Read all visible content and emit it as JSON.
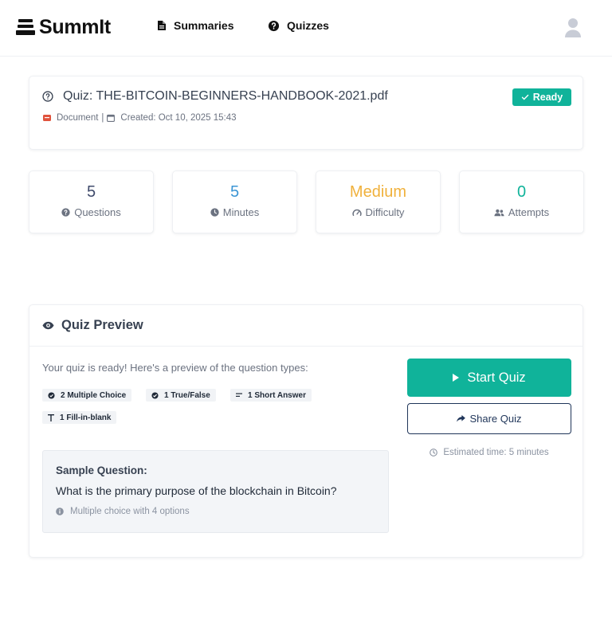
{
  "header": {
    "brand": "SummIt",
    "nav": [
      {
        "label": "Summaries",
        "icon": "document-icon"
      },
      {
        "label": "Quizzes",
        "icon": "question-circle-icon"
      }
    ],
    "avatar_icon": "user-icon"
  },
  "quiz": {
    "title": "Quiz: THE-BITCOIN-BEGINNERS-HANDBOOK-2021.pdf",
    "source_type": "Document",
    "meta_separator": "|",
    "created": "Created: Oct 10, 2025 15:43",
    "status": "Ready",
    "status_color": "#10b39a"
  },
  "stats": [
    {
      "value": "5",
      "label": "Questions",
      "color": "#3f4a6b",
      "icon": "question-circle-icon"
    },
    {
      "value": "5",
      "label": "Minutes",
      "color": "#3b95d4",
      "icon": "clock-icon"
    },
    {
      "value": "Medium",
      "label": "Difficulty",
      "color": "#f0b13c",
      "icon": "gauge-icon"
    },
    {
      "value": "0",
      "label": "Attempts",
      "color": "#10b39a",
      "icon": "users-icon"
    }
  ],
  "preview": {
    "title": "Quiz Preview",
    "intro": "Your quiz is ready! Here's a preview of the question types:",
    "chips": [
      {
        "label": "2 Multiple Choice",
        "icon": "list-check-icon"
      },
      {
        "label": "1 True/False",
        "icon": "check-circle-icon"
      },
      {
        "label": "1 Short Answer",
        "icon": "short-text-icon"
      },
      {
        "label": "1 Fill-in-blank",
        "icon": "text-icon"
      }
    ],
    "sample_label": "Sample Question:",
    "sample_question": "What is the primary purpose of the blockchain in Bitcoin?",
    "sample_note": "Multiple choice with 4 options",
    "start_button": "Start Quiz",
    "share_button": "Share Quiz",
    "estimated_time": "Estimated time: 5 minutes",
    "accent": "#10b39a",
    "share_color": "#1f3559"
  }
}
